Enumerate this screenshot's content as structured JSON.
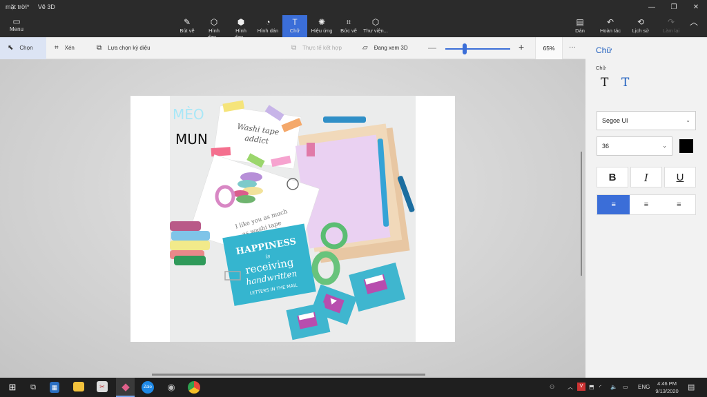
{
  "titlebar": {
    "doc_title": "mặt trời*",
    "app_name": "Vẽ 3D"
  },
  "window_controls": [
    "—",
    "❐",
    "✕"
  ],
  "menu": {
    "label": "Menu"
  },
  "ribbon_tools": [
    {
      "label": "Bút vẽ",
      "icon": "brush-icon",
      "glyph": "✎"
    },
    {
      "label": "Hình dạn...",
      "icon": "shapes-2d-icon",
      "glyph": "⬡"
    },
    {
      "label": "Hình dạn...",
      "icon": "shapes-3d-icon",
      "glyph": "⬢"
    },
    {
      "label": "Hình dán",
      "icon": "sticker-icon",
      "glyph": "◔"
    },
    {
      "label": "Chữ",
      "icon": "text-icon",
      "glyph": "T"
    },
    {
      "label": "Hiệu ứng",
      "icon": "effects-icon",
      "glyph": "✺"
    },
    {
      "label": "Bức vẽ",
      "icon": "canvas-icon",
      "glyph": "⌗"
    },
    {
      "label": "Thư viện...",
      "icon": "library-icon",
      "glyph": "⬡"
    }
  ],
  "right_tools": [
    {
      "label": "Dán",
      "icon": "paste-icon",
      "glyph": "📋"
    },
    {
      "label": "Hoàn tác",
      "icon": "undo-icon",
      "glyph": "↶"
    },
    {
      "label": "Lịch sử",
      "icon": "history-icon",
      "glyph": "⟲"
    },
    {
      "label": "Làm lại",
      "icon": "redo-icon",
      "glyph": "↷"
    }
  ],
  "toolbar2": {
    "select": "Chọn",
    "crop": "Xén",
    "magic_select": "Lựa chọn kỳ diệu",
    "mixed_reality": "Thực tế kết hợp",
    "view_3d": "Đang xem 3D",
    "zoom_percent": "65%",
    "zoom_level": 0.3,
    "more": "···"
  },
  "canvas_text": {
    "line1": "MÈO",
    "line2": "MUN"
  },
  "photo_text": {
    "washi": "Washi tape",
    "addict": "addict",
    "like1": "I like you as much",
    "like2": "as washi tape",
    "happiness": "HAPPINESS",
    "is": "is",
    "receiving": "receiving",
    "handwritten": "handwritten",
    "letters": "LETTERS IN THE MAIL"
  },
  "panel": {
    "title": "Chữ",
    "subtitle": "Chữ",
    "font": "Segoe UI",
    "size": "36",
    "color": "#000000",
    "bold": "B",
    "italic": "I",
    "underline": "U",
    "align": [
      "≡",
      "≡",
      "≡"
    ]
  },
  "taskbar": {
    "lang": "ENG",
    "time": "4:46 PM",
    "date": "9/13/2020",
    "apps": [
      "start-icon",
      "task-view-icon",
      "calculator-icon",
      "file-explorer-icon",
      "snip-icon",
      "paint-3d-icon",
      "zalo-icon",
      "camera-icon",
      "chrome-icon"
    ]
  }
}
